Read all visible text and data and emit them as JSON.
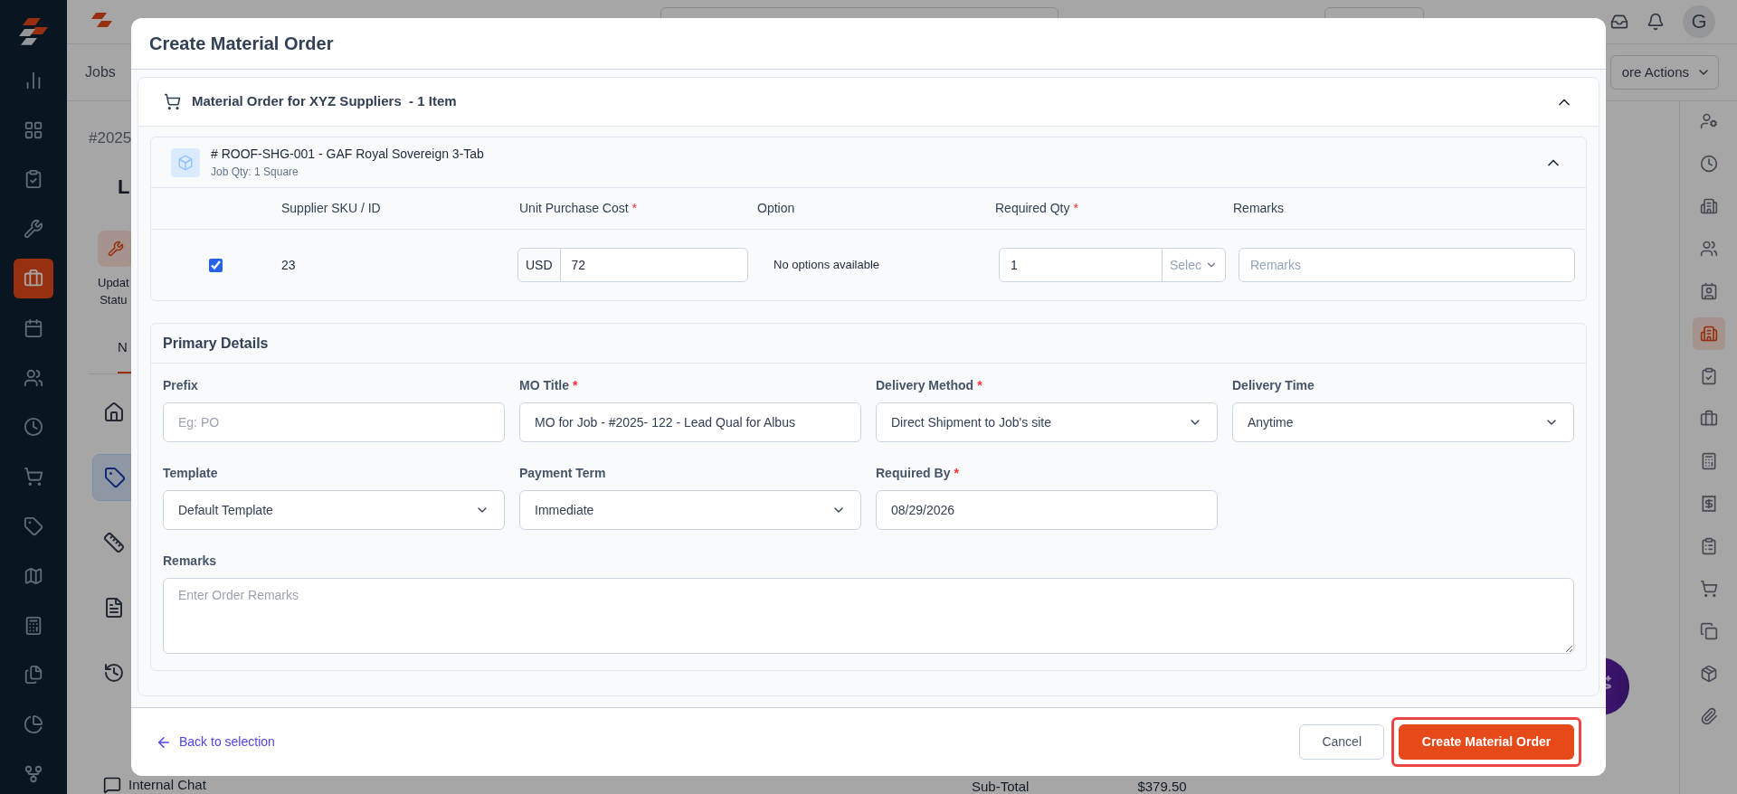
{
  "background": {
    "breadcrumb": "Jobs",
    "job_id": "#2025",
    "heading": "L",
    "update_lines": [
      "Updat",
      "Statu"
    ],
    "tab": "N",
    "chat_item": "Internal Chat",
    "more_actions": "ore Actions",
    "subtotal_label": "Sub-Total",
    "subtotal_value": "$379.50",
    "avatar": "G",
    "left_rail": [
      {
        "selected": false
      },
      {
        "selected": false
      },
      {
        "selected": false
      },
      {
        "selected": false
      },
      {
        "selected": true
      },
      {
        "selected": false
      },
      {
        "selected": false
      },
      {
        "selected": false
      },
      {
        "selected": false
      },
      {
        "selected": false
      },
      {
        "selected": false
      },
      {
        "selected": false
      },
      {
        "selected": false
      },
      {
        "selected": false
      },
      {
        "selected": false
      }
    ],
    "nav_items": [
      {
        "selected": false
      },
      {
        "selected": true
      },
      {
        "selected": false
      },
      {
        "selected": false
      },
      {
        "selected": false
      }
    ],
    "right_rail": [
      {
        "selected": false
      },
      {
        "selected": false
      },
      {
        "selected": false
      },
      {
        "selected": false
      },
      {
        "selected": false
      },
      {
        "selected": true
      },
      {
        "selected": false
      },
      {
        "selected": false
      },
      {
        "selected": false
      },
      {
        "selected": false
      },
      {
        "selected": false
      },
      {
        "selected": false
      },
      {
        "selected": false
      },
      {
        "selected": false
      },
      {
        "selected": false
      }
    ]
  },
  "modal": {
    "title": "Create Material Order",
    "required_mark": "*",
    "supplier": {
      "title": "Material Order for XYZ Suppliers",
      "count": "- 1 Item",
      "expanded": true
    },
    "item": {
      "title": "# ROOF-SHG-001 - GAF Royal Sovereign 3-Tab",
      "subtitle": "Job Qty: 1 Square",
      "expanded": true,
      "columns": [
        {
          "label": "Supplier SKU / ID",
          "required": false
        },
        {
          "label": "Unit Purchase Cost",
          "required": true
        },
        {
          "label": "Option",
          "required": false
        },
        {
          "label": "Required Qty",
          "required": true
        },
        {
          "label": "Remarks",
          "required": false
        }
      ],
      "row": {
        "checked": true,
        "sku": "23",
        "currency": "USD",
        "cost": "72",
        "option": "No options available",
        "qty": "1",
        "unit_placeholder": "Selec",
        "remarks_placeholder": "Remarks"
      }
    },
    "primary": {
      "title": "Primary Details",
      "fields": [
        {
          "label": "Prefix",
          "required": false,
          "kind": "input",
          "placeholder": "Eg: PO"
        },
        {
          "label": "MO Title",
          "required": true,
          "kind": "input",
          "value": "MO for Job - #2025- 122 - Lead Qual for Albus"
        },
        {
          "label": "Delivery Method",
          "required": true,
          "kind": "select",
          "value": "Direct Shipment to Job's site"
        },
        {
          "label": "Delivery Time",
          "required": false,
          "kind": "select",
          "value": "Anytime"
        },
        {
          "label": "Template",
          "required": false,
          "kind": "select",
          "value": "Default Template"
        },
        {
          "label": "Payment Term",
          "required": false,
          "kind": "select",
          "value": "Immediate"
        },
        {
          "label": "Required By",
          "required": true,
          "kind": "input",
          "value": "08/29/2026"
        },
        {
          "label": "Remarks",
          "required": false,
          "kind": "textarea",
          "placeholder": "Enter Order Remarks"
        }
      ]
    },
    "footer": {
      "back": "Back to selection",
      "cancel": "Cancel",
      "submit": "Create Material Order",
      "submit_highlighted": true
    }
  }
}
